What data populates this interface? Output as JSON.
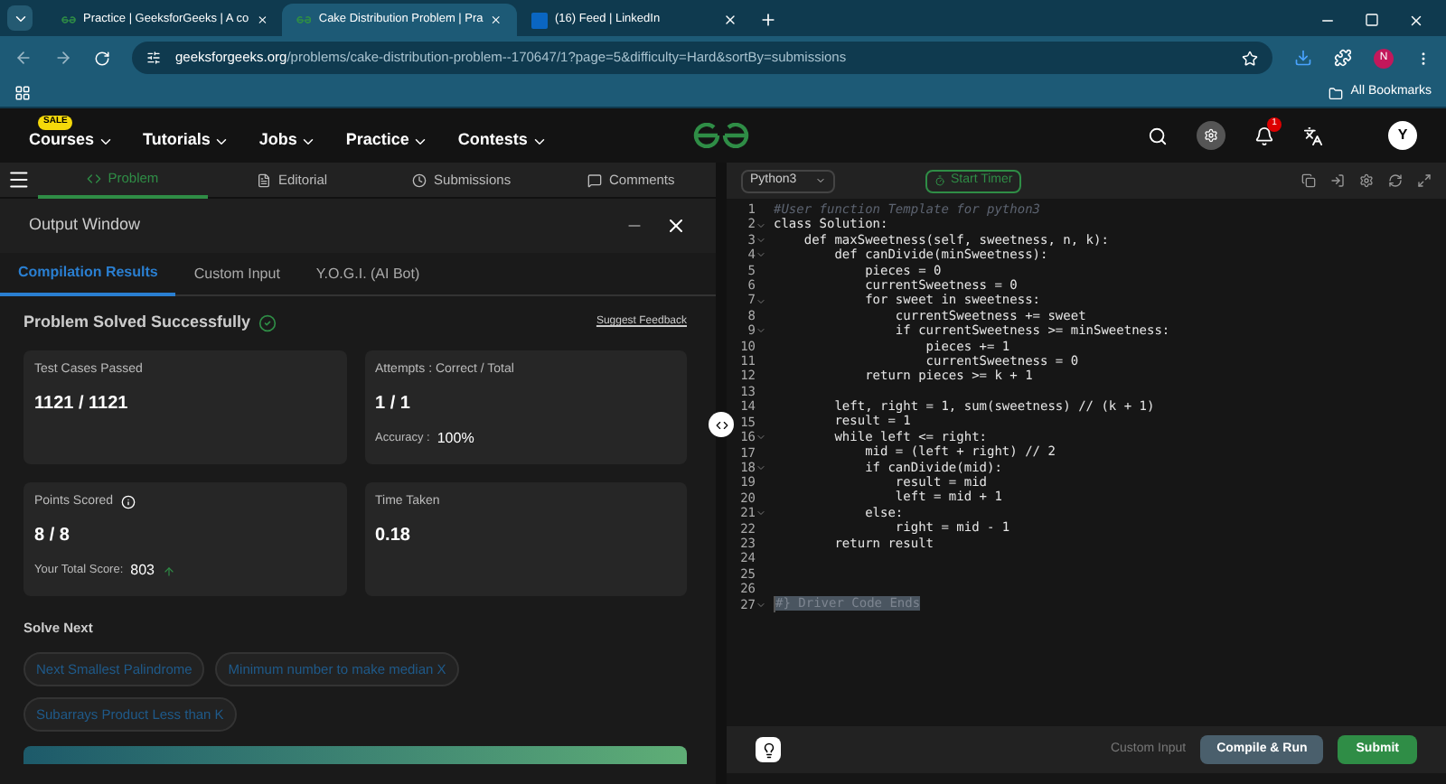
{
  "browser": {
    "tabs": [
      {
        "title": "Practice | GeeksforGeeks | A co",
        "selected": false,
        "kind": "gfg"
      },
      {
        "title": "Cake Distribution Problem | Pra",
        "selected": true,
        "kind": "gfg"
      },
      {
        "title": "(16) Feed | LinkedIn",
        "selected": false,
        "kind": "linkedin"
      }
    ],
    "url_domain": "geeksforgeeks.org",
    "url_path": "/problems/cake-distribution-problem--170647/1?page=5&difficulty=Hard&sortBy=submissions",
    "profile": "N",
    "bookmarks": "All Bookmarks"
  },
  "site_nav": {
    "sale_badge": "SALE",
    "items": [
      "Courses",
      "Tutorials",
      "Jobs",
      "Practice",
      "Contests"
    ],
    "notification_count": "1",
    "avatar": "Y"
  },
  "problem_tabs": [
    {
      "label": "Problem",
      "selected": true
    },
    {
      "label": "Editorial",
      "selected": false
    },
    {
      "label": "Submissions",
      "selected": false
    },
    {
      "label": "Comments",
      "selected": false
    }
  ],
  "output_window": {
    "title": "Output Window",
    "tabs": [
      {
        "label": "Compilation Results",
        "selected": true
      },
      {
        "label": "Custom Input",
        "selected": false
      },
      {
        "label": "Y.O.G.I. (AI Bot)",
        "selected": false
      }
    ],
    "status": "Problem Solved Successfully",
    "feedback_link": "Suggest Feedback",
    "cards": [
      {
        "label": "Test Cases Passed",
        "value": "1121 / 1121"
      },
      {
        "label": "Attempts : Correct / Total",
        "value": "1 / 1",
        "extra_label": "Accuracy :",
        "extra_value": "100%"
      },
      {
        "label": "Points Scored",
        "value": "8 / 8",
        "info": true,
        "extra_label": "Your Total Score:",
        "extra_value": "803",
        "trending_up": true
      },
      {
        "label": "Time Taken",
        "value": "0.18"
      }
    ],
    "solve_next_title": "Solve Next",
    "suggestions": [
      "Next Smallest Palindrome",
      "Minimum number to make median X",
      "Subarrays Product Less than K"
    ]
  },
  "editor": {
    "language": "Python3",
    "timer": "Start Timer",
    "lines": [
      {
        "number": "1",
        "text": "#User function Template for python3",
        "kind": "comment",
        "foldable": false
      },
      {
        "number": "2",
        "text": "class Solution:",
        "kind": "code",
        "foldable": true
      },
      {
        "number": "3",
        "text": "    def maxSweetness(self, sweetness, n, k):",
        "kind": "code",
        "foldable": true
      },
      {
        "number": "4",
        "text": "        def canDivide(minSweetness):",
        "kind": "code",
        "foldable": true
      },
      {
        "number": "5",
        "text": "            pieces = 0",
        "kind": "code",
        "foldable": false
      },
      {
        "number": "6",
        "text": "            currentSweetness = 0",
        "kind": "code",
        "foldable": false
      },
      {
        "number": "7",
        "text": "            for sweet in sweetness:",
        "kind": "code",
        "foldable": true
      },
      {
        "number": "8",
        "text": "                currentSweetness += sweet",
        "kind": "code",
        "foldable": false
      },
      {
        "number": "9",
        "text": "                if currentSweetness >= minSweetness:",
        "kind": "code",
        "foldable": true
      },
      {
        "number": "10",
        "text": "                    pieces += 1",
        "kind": "code",
        "foldable": false
      },
      {
        "number": "11",
        "text": "                    currentSweetness = 0",
        "kind": "code",
        "foldable": false
      },
      {
        "number": "12",
        "text": "            return pieces >= k + 1",
        "kind": "code",
        "foldable": false
      },
      {
        "number": "13",
        "kind": "code",
        "foldable": false
      },
      {
        "number": "14",
        "text": "        left, right = 1, sum(sweetness) // (k + 1)",
        "kind": "code",
        "foldable": false
      },
      {
        "number": "15",
        "text": "        result = 1",
        "kind": "code",
        "foldable": false
      },
      {
        "number": "16",
        "text": "        while left <= right:",
        "kind": "code",
        "foldable": true
      },
      {
        "number": "17",
        "text": "            mid = (left + right) // 2",
        "kind": "code",
        "foldable": false
      },
      {
        "number": "18",
        "text": "            if canDivide(mid):",
        "kind": "code",
        "foldable": true
      },
      {
        "number": "19",
        "text": "                result = mid",
        "kind": "code",
        "foldable": false
      },
      {
        "number": "20",
        "text": "                left = mid + 1",
        "kind": "code",
        "foldable": false
      },
      {
        "number": "21",
        "text": "            else:",
        "kind": "code",
        "foldable": true
      },
      {
        "number": "22",
        "text": "                right = mid - 1",
        "kind": "code",
        "foldable": false
      },
      {
        "number": "23",
        "text": "        return result",
        "kind": "code",
        "foldable": false
      },
      {
        "number": "24",
        "kind": "code",
        "foldable": false
      },
      {
        "number": "25",
        "kind": "code",
        "foldable": false
      },
      {
        "number": "26",
        "kind": "code",
        "foldable": false
      },
      {
        "number": "27",
        "text": "#} Driver Code Ends",
        "kind": "selected",
        "foldable": true
      }
    ],
    "custom_input": "Custom Input",
    "compile": "Compile & Run",
    "submit": "Submit"
  }
}
